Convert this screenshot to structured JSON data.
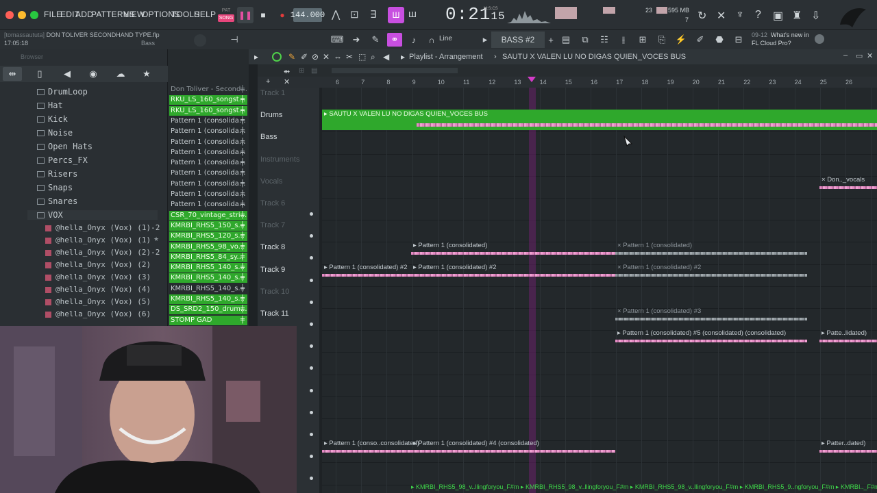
{
  "menu": [
    "FILE",
    "EDIT",
    "ADD",
    "PATTERNS",
    "VIEW",
    "OPTIONS",
    "TOOLS",
    "HELP"
  ],
  "transport": {
    "pat": "PAT",
    "song": "SONG",
    "tempo": "144.000",
    "time_main": "0:21",
    "time_sub": "15",
    "time_unit": "M:S:CS"
  },
  "cpu": {
    "value": "23",
    "memory": "595 MB",
    "voices": "7"
  },
  "project": {
    "user": "[tomassaututa]",
    "name": "DON TOLIVER SECONDHAND TYPE.flp",
    "time": "17:05:18",
    "hint": "Bass"
  },
  "toolbar": {
    "snap": "Line",
    "pattern": "BASS #2",
    "news_date": "09-12",
    "news_line1": "What's new in",
    "news_line2": "FL Cloud Pro?"
  },
  "browser": {
    "title": "Browser",
    "folders": [
      "DrumLoop",
      "Hat",
      "Kick",
      "Noise",
      "Open Hats",
      "Percs_FX",
      "Risers",
      "Snaps",
      "Snares",
      "VOX"
    ],
    "samples": [
      "@hella_Onyx (Vox) (1)-2",
      "@hella_Onyx (Vox) (1)",
      "@hella_Onyx (Vox) (2)-2",
      "@hella_Onyx (Vox) (2)",
      "@hella_Onyx (Vox) (3)",
      "@hella_Onyx (Vox) (4)",
      "@hella_Onyx (Vox) (5)",
      "@hella_Onyx (Vox) (6)"
    ]
  },
  "picker": [
    {
      "label": "Don Toliver - Second...",
      "style": "grey"
    },
    {
      "label": "RKU_LS_160_songst...",
      "style": "green"
    },
    {
      "label": "RKU_LS_160_songst...",
      "style": "green"
    },
    {
      "label": "Pattern 1 (consolida...",
      "style": "grey"
    },
    {
      "label": "Pattern 1 (consolida...",
      "style": "grey"
    },
    {
      "label": "Pattern 1 (consolida...",
      "style": "grey"
    },
    {
      "label": "Pattern 1 (consolida...",
      "style": "grey"
    },
    {
      "label": "Pattern 1 (consolida...",
      "style": "grey"
    },
    {
      "label": "Pattern 1 (consolida...",
      "style": "grey"
    },
    {
      "label": "Pattern 1 (consolida...",
      "style": "grey"
    },
    {
      "label": "Pattern 1 (consolida...",
      "style": "grey"
    },
    {
      "label": "Pattern 1 (consolida...",
      "style": "grey"
    },
    {
      "label": "CSR_70_vintage_stri...",
      "style": "green"
    },
    {
      "label": "KMRBI_RHS5_150_s...",
      "style": "green"
    },
    {
      "label": "KMRBI_RHS5_120_s...",
      "style": "green"
    },
    {
      "label": "KMRBI_RHS5_98_vo...",
      "style": "green"
    },
    {
      "label": "KMRBI_RHS5_84_sy...",
      "style": "green"
    },
    {
      "label": "KMRBI_RHS5_140_s...",
      "style": "green"
    },
    {
      "label": "KMRBI_RHS5_140_s...",
      "style": "green"
    },
    {
      "label": "KMRBI_RHS5_140_s...",
      "style": "grey"
    },
    {
      "label": "KMRBI_RHS5_140_s...",
      "style": "green"
    },
    {
      "label": "DS_SRD2_150_drum...",
      "style": "green"
    },
    {
      "label": "STOMP GAD",
      "style": "green"
    }
  ],
  "playlist": {
    "title": "Playlist - Arrangement",
    "subtitle": "SAUTU X VALEN LU NO DIGAS QUIEN_VOCES BUS",
    "ruler": [
      "6",
      "7",
      "8",
      "9",
      "10",
      "11",
      "12",
      "13",
      "14",
      "15",
      "16",
      "17",
      "18",
      "19",
      "20",
      "21",
      "22",
      "23",
      "24",
      "25",
      "26"
    ],
    "tracks": [
      "Track 1",
      "Drums",
      "Bass",
      "Instruments",
      "Vocals",
      "Track 6",
      "Track 7",
      "Track 8",
      "Track 9",
      "Track 10",
      "Track 11"
    ],
    "clips": {
      "bus": "SAUTU X VALEN LU NO DIGAS QUIEN_VOCES BUS",
      "don_vocals": "Don.._vocals",
      "t8a": "Pattern 1 (consolidated)",
      "t8b": "Pattern 1 (consolidated)",
      "t9a": "Pattern 1 (consolidated) #2",
      "t9b": "Pattern 1 (consolidated) #2",
      "t9c": "Pattern 1 (consolidated) #2",
      "t11a": "Pattern 1 (consolidated) #3",
      "t12a": "Pattern 1 (consolidated) #5 (consolidated) (consolidated)",
      "t12b": "Patte..lidated)",
      "b1": "Pattern 1 (conso..consolidated)",
      "b2": "Pattern 1 (consolidated) #4 (consolidated)",
      "b3": "Patter..dated)",
      "bottom": "KMRBI_RHS5_98_v..llingforyou_F#m",
      "bottom2": "KMRBI_RHS5_98_v..llingforyou_F#m",
      "bottom3": "KMRBI_RHS5_98_v..llingforyou_F#m",
      "bottom4": "KMRBI_RHS5_9..ngforyou_F#m",
      "bottom5": "KMRBI.._F#m"
    }
  }
}
